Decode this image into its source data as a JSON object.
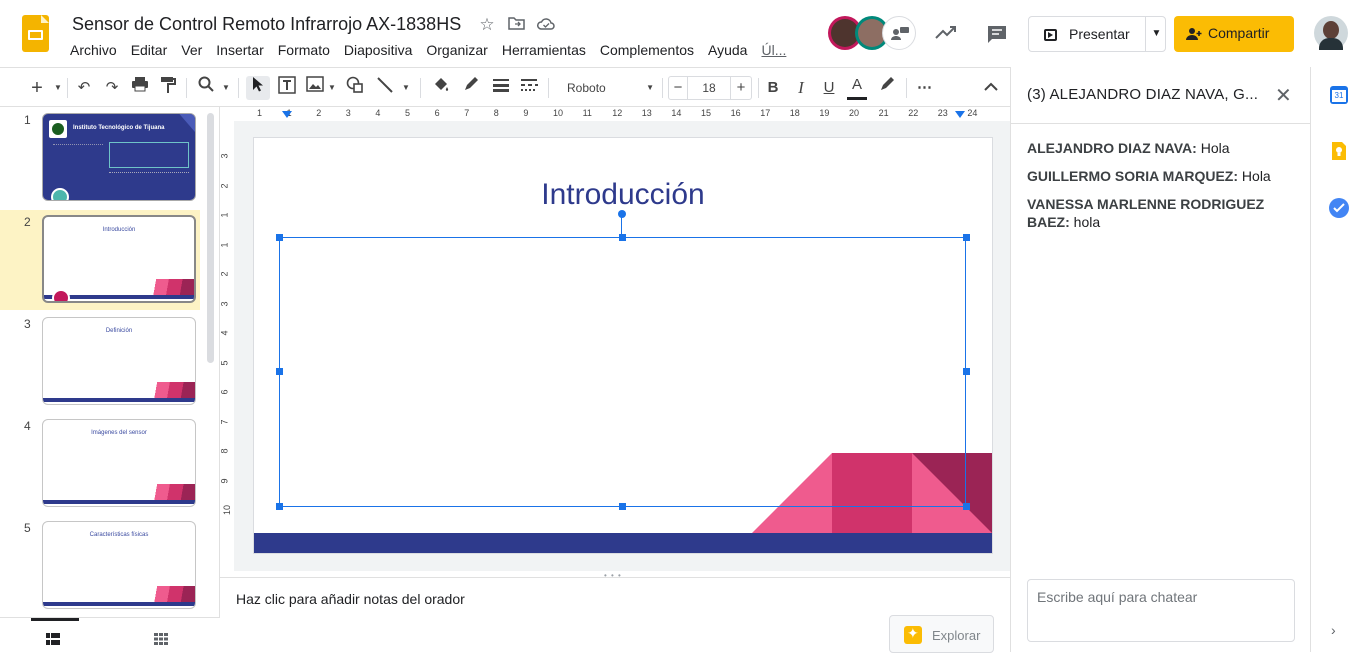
{
  "doc": {
    "title": "Sensor de Control Remoto Infrarrojo AX-1838HS"
  },
  "menu": [
    "Archivo",
    "Editar",
    "Ver",
    "Insertar",
    "Formato",
    "Diapositiva",
    "Organizar",
    "Herramientas",
    "Complementos",
    "Ayuda",
    "Úl..."
  ],
  "header": {
    "present_label": "Presentar",
    "share_label": "Compartir"
  },
  "toolbar": {
    "font": "Roboto",
    "font_size": "18"
  },
  "slides": [
    {
      "num": "1",
      "title": "Instituto Tecnológico de Tijuana"
    },
    {
      "num": "2",
      "title": "Introducción"
    },
    {
      "num": "3",
      "title": "Definición"
    },
    {
      "num": "4",
      "title": "Imágenes del sensor"
    },
    {
      "num": "5",
      "title": "Características físicas"
    }
  ],
  "ruler_top": [
    "1",
    "1",
    "2",
    "3",
    "4",
    "5",
    "6",
    "7",
    "8",
    "9",
    "10",
    "11",
    "12",
    "13",
    "14",
    "15",
    "16",
    "17",
    "18",
    "19",
    "20",
    "21",
    "22",
    "23",
    "24"
  ],
  "ruler_left": [
    "3",
    "2",
    "1",
    "1",
    "2",
    "3",
    "4",
    "5",
    "6",
    "7",
    "8",
    "9",
    "10"
  ],
  "current_slide": {
    "title": "Introducción"
  },
  "notes": {
    "placeholder": "Haz clic para añadir notas del orador"
  },
  "explore": {
    "label": "Explorar"
  },
  "chat": {
    "title": "(3) ALEJANDRO DIAZ NAVA, G...",
    "messages": [
      {
        "author": "ALEJANDRO DIAZ NAVA:",
        "text": " Hola"
      },
      {
        "author": "GUILLERMO SORIA MARQUEZ:",
        "text": " Hola"
      },
      {
        "author": "VANESSA MARLENNE RODRIGUEZ BAEZ:",
        "text": " hola"
      }
    ],
    "input_placeholder": "Escribe aquí para chatear"
  },
  "side_apps": {
    "calendar_day": "31"
  },
  "colors": {
    "accent": "#1a73e8",
    "brand": "#f4b400",
    "slide_title": "#2e3a8c",
    "share": "#fbbc04"
  }
}
